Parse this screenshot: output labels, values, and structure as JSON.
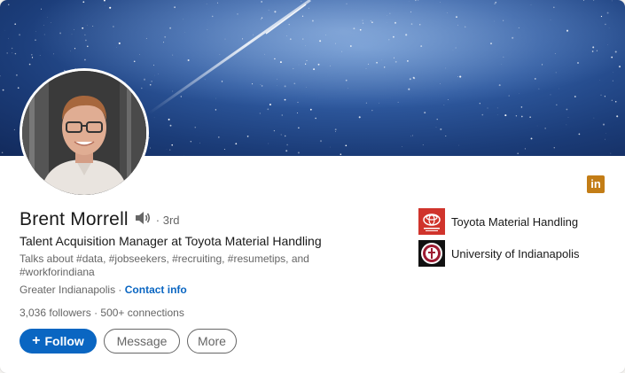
{
  "profile": {
    "name": "Brent Morrell",
    "degree": "· 3rd",
    "headline": "Talent Acquisition Manager at Toyota Material Handling",
    "talks_about": "Talks about #data, #jobseekers, #recruiting, #resumetips, and #workforindiana",
    "location": "Greater Indianapolis ·",
    "contact_info": "Contact info",
    "followers": "3,036 followers",
    "separator": "·",
    "connections": "500+ connections"
  },
  "actions": {
    "follow_icon": "+",
    "follow_label": "Follow",
    "message_label": "Message",
    "more_label": "More"
  },
  "organizations": [
    {
      "name": "Toyota Material Handling",
      "icon": "toyota-logo"
    },
    {
      "name": "University of Indianapolis",
      "icon": "uindy-seal"
    }
  ],
  "badge": {
    "text": "in",
    "icon": "linkedin-icon"
  },
  "colors": {
    "accent": "#0a66c2",
    "badge": "#c37d16",
    "toyota_red": "#d0342c",
    "uindy_crimson": "#9e1b32"
  }
}
